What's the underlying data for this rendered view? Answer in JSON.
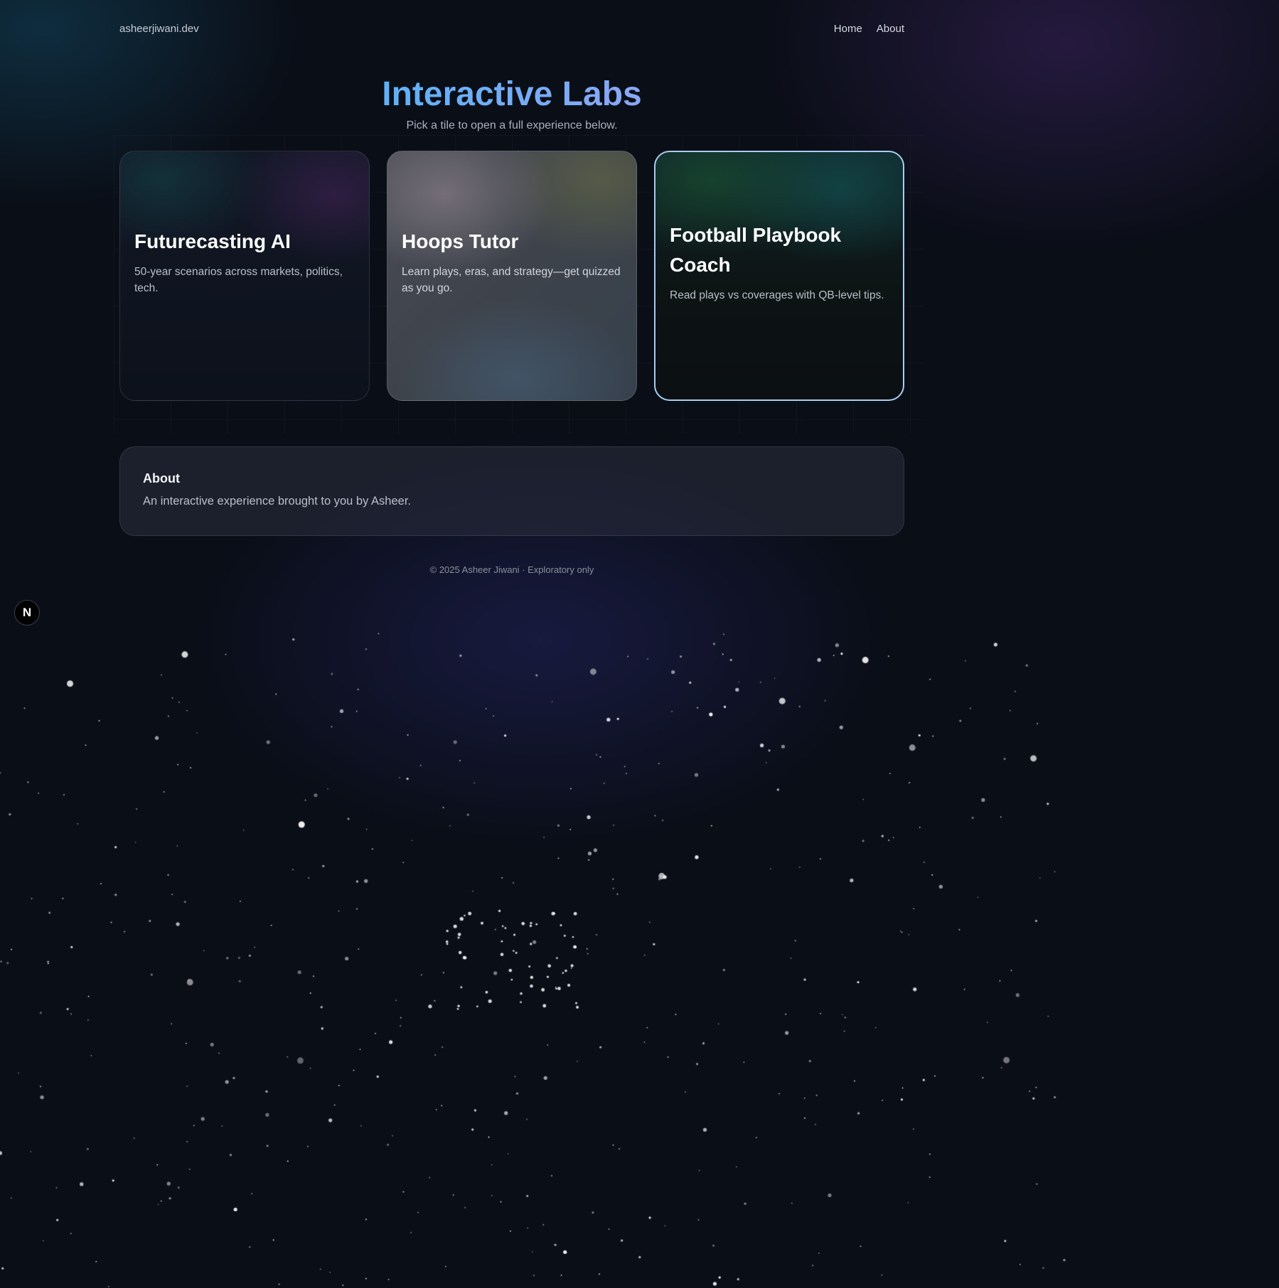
{
  "nav": {
    "brand": "asheerjiwani.dev",
    "links": [
      {
        "label": "Home"
      },
      {
        "label": "About"
      }
    ]
  },
  "hero": {
    "title": "Interactive Labs",
    "subtitle": "Pick a tile to open a full experience below."
  },
  "tiles": [
    {
      "title": "Futurecasting AI",
      "description": "50-year scenarios across markets, politics, tech."
    },
    {
      "title": "Hoops Tutor",
      "description": "Learn plays, eras, and strategy—get quizzed as you go."
    },
    {
      "title": "Football Playbook Coach",
      "description": "Read plays vs coverages with QB-level tips.",
      "selected": true
    }
  ],
  "about": {
    "heading": "About",
    "text": "An interactive experience brought to you by Asheer."
  },
  "footer": {
    "text": "© 2025 Asheer Jiwani · Exploratory only"
  },
  "dev_badge": {
    "letter": "N",
    "icon": "nextjs-icon"
  },
  "colors": {
    "background": "#0a0e17",
    "title_gradient_start": "#5fb1f5",
    "title_gradient_end": "#8aa7f5",
    "selected_border": "#a9cdf0"
  }
}
